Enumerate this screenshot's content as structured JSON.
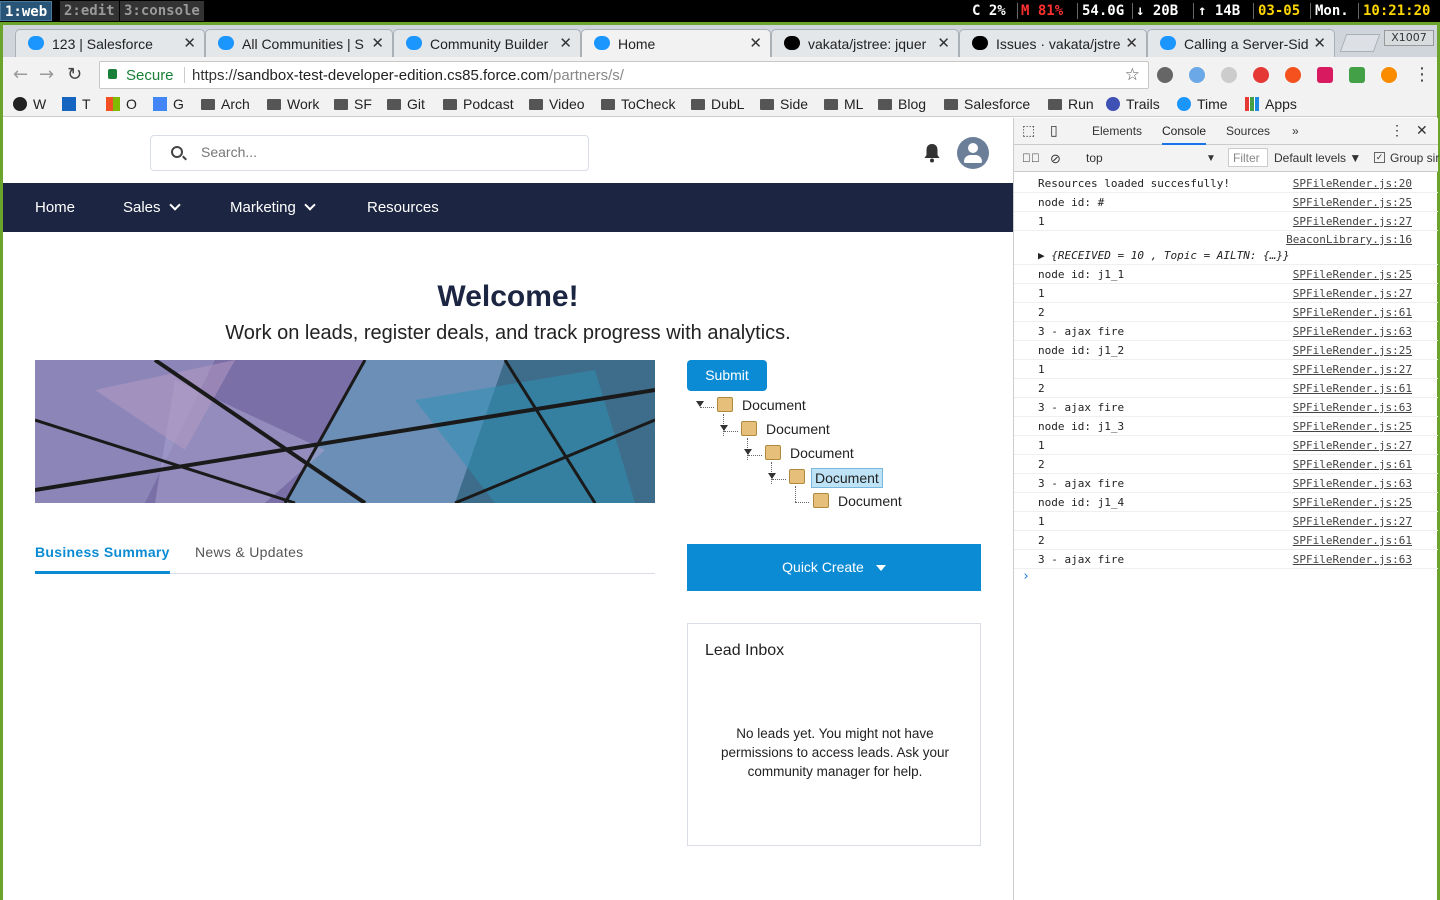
{
  "statusbar": {
    "workspaces": [
      "1:web",
      "2:edit",
      "3:console"
    ],
    "cpu": "C 2%",
    "mem": "M 81%",
    "disk": "54.0G",
    "net_down": "↓ 20B",
    "net_up": "↑ 14B",
    "date": "03-05",
    "day": "Mon.",
    "time": "10:21:20"
  },
  "browser": {
    "tabs": [
      {
        "title": "123 | Salesforce",
        "icon": "salesforce-icon"
      },
      {
        "title": "All Communities | S",
        "icon": "salesforce-icon"
      },
      {
        "title": "Community Builder",
        "icon": "salesforce-icon"
      },
      {
        "title": "Home",
        "icon": "salesforce-icon"
      },
      {
        "title": "vakata/jstree: jquer",
        "icon": "github-icon"
      },
      {
        "title": "Issues · vakata/jstre",
        "icon": "github-icon"
      },
      {
        "title": "Calling a Server-Sid",
        "icon": "salesforce-icon"
      }
    ],
    "window_label": "X1007",
    "secure_label": "Secure",
    "url_scheme": "https://",
    "url_host": "sandbox-test-developer-edition.cs85.force.com",
    "url_path": "/partners/s/",
    "bookmarks": [
      {
        "label": "W",
        "type": "site"
      },
      {
        "label": "T",
        "type": "site"
      },
      {
        "label": "O",
        "type": "site"
      },
      {
        "label": "G",
        "type": "site"
      },
      {
        "label": "Arch",
        "type": "folder"
      },
      {
        "label": "Work",
        "type": "folder"
      },
      {
        "label": "SF",
        "type": "folder"
      },
      {
        "label": "Git",
        "type": "folder"
      },
      {
        "label": "Podcast",
        "type": "folder"
      },
      {
        "label": "Video",
        "type": "folder"
      },
      {
        "label": "ToCheck",
        "type": "folder"
      },
      {
        "label": "DubL",
        "type": "folder"
      },
      {
        "label": "Side",
        "type": "folder"
      },
      {
        "label": "ML",
        "type": "folder"
      },
      {
        "label": "Blog",
        "type": "folder"
      },
      {
        "label": "Salesforce",
        "type": "folder"
      },
      {
        "label": "Run",
        "type": "folder"
      },
      {
        "label": "Trails",
        "type": "site"
      },
      {
        "label": "Time",
        "type": "site"
      },
      {
        "label": "Apps",
        "type": "site"
      }
    ]
  },
  "page": {
    "search_placeholder": "Search...",
    "nav": [
      "Home",
      "Sales",
      "Marketing",
      "Resources"
    ],
    "welcome": "Welcome!",
    "tagline": "Work on leads, register deals, and track progress with analytics.",
    "submit_label": "Submit",
    "tree": [
      "Document",
      "Document",
      "Document",
      "Document",
      "Document"
    ],
    "tabs": [
      "Business Summary",
      "News & Updates"
    ],
    "quick_create": "Quick Create",
    "lead_inbox": {
      "title": "Lead Inbox",
      "message": "No leads yet. You might not have permissions to access leads. Ask your community manager for help."
    }
  },
  "devtools": {
    "tabs": [
      "Elements",
      "Console",
      "Sources"
    ],
    "context": "top",
    "filter_placeholder": "Filter",
    "levels": "Default levels ▼",
    "group_label": "Group sir",
    "logs": [
      {
        "msg": "Resources loaded succesfully!",
        "src": "SPFileRender.js:20"
      },
      {
        "msg": "node id: #",
        "src": "SPFileRender.js:25"
      },
      {
        "msg": "1",
        "src": "SPFileRender.js:27"
      },
      {
        "msg": "▶ {RECEIVED = 10 , Topic = AILTN: {…}}",
        "src": "BeaconLibrary.js:16",
        "tall": true
      },
      {
        "msg": "node id: j1_1",
        "src": "SPFileRender.js:25"
      },
      {
        "msg": "1",
        "src": "SPFileRender.js:27"
      },
      {
        "msg": "2",
        "src": "SPFileRender.js:61"
      },
      {
        "msg": "3 - ajax fire",
        "src": "SPFileRender.js:63"
      },
      {
        "msg": "node id: j1_2",
        "src": "SPFileRender.js:25"
      },
      {
        "msg": "1",
        "src": "SPFileRender.js:27"
      },
      {
        "msg": "2",
        "src": "SPFileRender.js:61"
      },
      {
        "msg": "3 - ajax fire",
        "src": "SPFileRender.js:63"
      },
      {
        "msg": "node id: j1_3",
        "src": "SPFileRender.js:25"
      },
      {
        "msg": "1",
        "src": "SPFileRender.js:27"
      },
      {
        "msg": "2",
        "src": "SPFileRender.js:61"
      },
      {
        "msg": "3 - ajax fire",
        "src": "SPFileRender.js:63"
      },
      {
        "msg": "node id: j1_4",
        "src": "SPFileRender.js:25"
      },
      {
        "msg": "1",
        "src": "SPFileRender.js:27"
      },
      {
        "msg": "2",
        "src": "SPFileRender.js:61"
      },
      {
        "msg": "3 - ajax fire",
        "src": "SPFileRender.js:63"
      }
    ],
    "prompt": "›"
  }
}
